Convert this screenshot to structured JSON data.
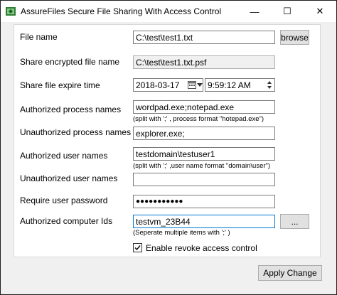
{
  "window": {
    "title": "AssureFiles Secure File Sharing With Access Control",
    "minimize_symbol": "—",
    "maximize_symbol": "☐",
    "close_symbol": "✕",
    "icon": "app-icon"
  },
  "form": {
    "file_name": {
      "label": "File name",
      "value": "C:\\test\\test1.txt",
      "button": "browse"
    },
    "encrypted_name": {
      "label": "Share encrypted file name",
      "value": "C:\\test\\test1.txt.psf"
    },
    "expire": {
      "label": "Share file expire time",
      "date": "2018-03-17",
      "time": "9:59:12 AM"
    },
    "authorized_process": {
      "label": "Authorized process names",
      "value": "wordpad.exe;notepad.exe",
      "hint": "(split with ';' , process format \"hotepad.exe\")"
    },
    "unauthorized_process": {
      "label": "Unauthorized  process names",
      "value": "explorer.exe;"
    },
    "authorized_users": {
      "label": "Authorized user names",
      "value": "testdomain\\testuser1",
      "hint": "(split with ';' ,user name format \"domain\\user\")"
    },
    "unauthorized_users": {
      "label": "Unauthorized user names",
      "value": ""
    },
    "password": {
      "label": "Require user password",
      "mask": "●●●●●●●●●●●"
    },
    "computer_ids": {
      "label": "Authorized  computer Ids",
      "value": "testvm_23B44",
      "hint": "(Seperate multiple items with ';' )",
      "button": "..."
    },
    "revoke": {
      "label": "Enable revoke access control",
      "checked": true
    }
  },
  "footer": {
    "apply_label": "Apply Change"
  },
  "colors": {
    "accent": "#0078d7",
    "window_bg": "#f0f0f0",
    "panel_bg": "#ffffff"
  }
}
